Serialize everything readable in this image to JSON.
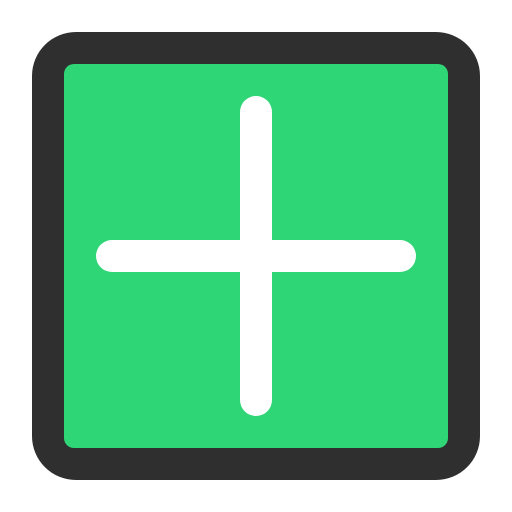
{
  "icon": {
    "name": "plus-icon",
    "frame_color": "#2f2f2f",
    "fill_color": "#2fd676",
    "glyph_color": "#ffffff"
  }
}
